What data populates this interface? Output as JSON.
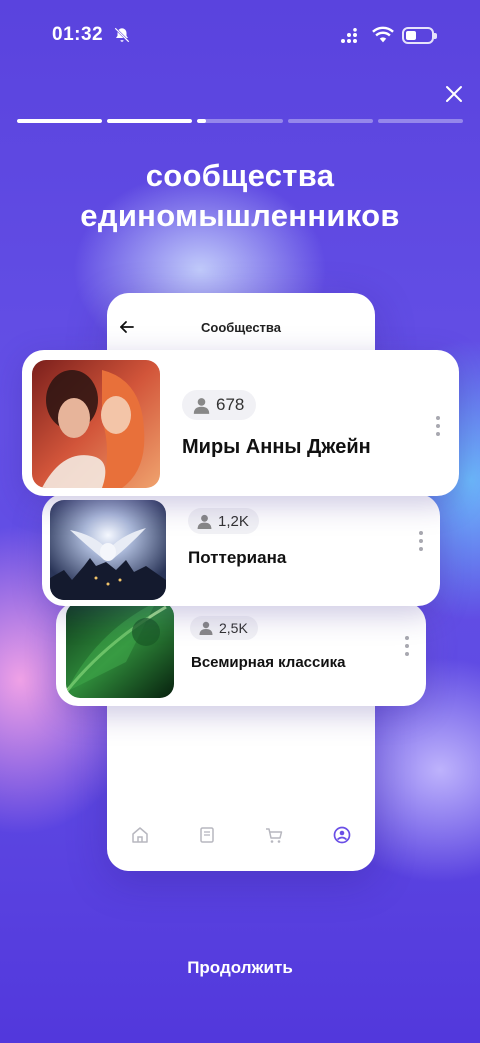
{
  "status_bar": {
    "time": "01:32"
  },
  "headline": {
    "line1": "сообщества",
    "line2": "единомышленников"
  },
  "progress": {
    "segments": 5,
    "current_segment": 3,
    "fills": [
      1,
      1,
      0.1,
      0,
      0
    ]
  },
  "phone": {
    "title": "Сообщества",
    "tabbar": [
      "home-icon",
      "book-icon",
      "cart-icon",
      "profile-icon"
    ]
  },
  "communities": [
    {
      "members": "678",
      "name": "Миры Анны Джейн"
    },
    {
      "members": "1,2K",
      "name": "Поттериана"
    },
    {
      "members": "2,5K",
      "name": "Всемирная классика"
    }
  ],
  "continue_label": "Продолжить",
  "colors": {
    "background": "#5b44e0",
    "accent": "#6a4fe6",
    "card": "#ffffff"
  }
}
